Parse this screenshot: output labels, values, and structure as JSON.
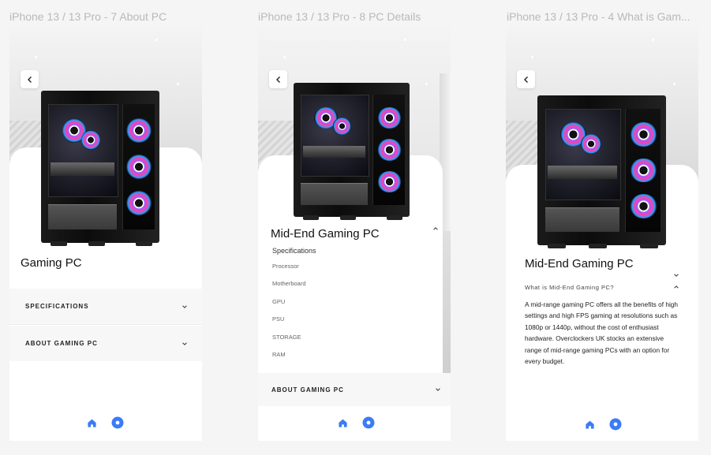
{
  "frames": [
    {
      "label": "iPhone 13 / 13 Pro - 7 About PC",
      "title": "Gaming PC",
      "accordion": [
        {
          "label": "SPECIFICATIONS"
        },
        {
          "label": "ABOUT GAMING PC"
        }
      ]
    },
    {
      "label": "iPhone 13 / 13 Pro - 8 PC Details",
      "title": "Mid-End Gaming PC",
      "specs_heading": "Specifications",
      "specs": [
        "Processor",
        "Motherboard",
        "GPU",
        "PSU",
        "STORAGE",
        "RAM"
      ],
      "accordion": [
        {
          "label": "ABOUT GAMING PC"
        }
      ]
    },
    {
      "label": "iPhone 13 / 13 Pro - 4 What is Gam...",
      "title": "Mid-End Gaming PC",
      "question": "What is Mid-End Gaming PC?",
      "answer": "A mid-range gaming PC offers all the benefits of high settings and high FPS gaming at resolutions such as 1080p or 1440p, without the cost of enthusiast hardware. Overclockers UK stocks an extensive range of mid-range gaming PCs with an option for every budget."
    }
  ],
  "icons": {
    "back": "chevron-left-icon",
    "home": "home-icon",
    "profile": "circle-icon",
    "expand": "chevron-down-icon",
    "collapse": "chevron-up-icon"
  },
  "colors": {
    "accent": "#3b7bf6",
    "background": "#f5f5f5",
    "row_bg": "#f7f7f7"
  }
}
